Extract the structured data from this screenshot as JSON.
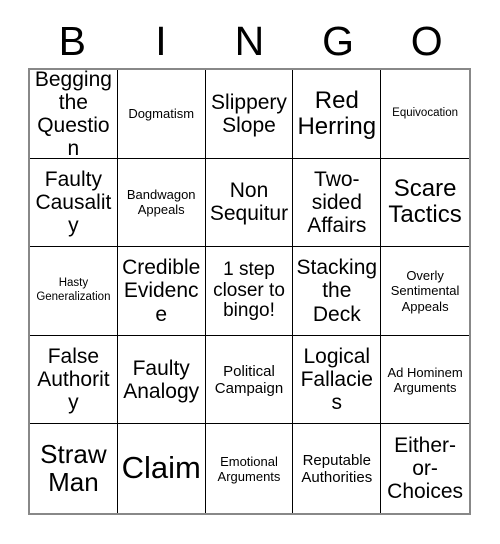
{
  "card": {
    "header_letters": [
      "B",
      "I",
      "N",
      "G",
      "O"
    ],
    "size": 5,
    "cells": [
      {
        "text": "Begging the Question",
        "size": "fs-xl"
      },
      {
        "text": "Dogmatism",
        "size": "fs-sm"
      },
      {
        "text": "Slippery Slope",
        "size": "fs-xl"
      },
      {
        "text": "Red Herring",
        "size": "fs-2xl"
      },
      {
        "text": "Equivocation",
        "size": "fs-xs"
      },
      {
        "text": "Faulty Causality",
        "size": "fs-xl"
      },
      {
        "text": "Bandwagon Appeals",
        "size": "fs-sm"
      },
      {
        "text": "Non Sequitur",
        "size": "fs-xl"
      },
      {
        "text": "Two-sided Affairs",
        "size": "fs-xl"
      },
      {
        "text": "Scare Tactics",
        "size": "fs-2xl"
      },
      {
        "text": "Hasty Generalization",
        "size": "fs-xs"
      },
      {
        "text": "Credible Evidence",
        "size": "fs-xl"
      },
      {
        "text": "1 step closer to bingo!",
        "size": "fs-lg"
      },
      {
        "text": "Stacking the Deck",
        "size": "fs-xl"
      },
      {
        "text": "Overly Sentimental Appeals",
        "size": "fs-sm"
      },
      {
        "text": "False Authority",
        "size": "fs-xl"
      },
      {
        "text": "Faulty Analogy",
        "size": "fs-xl"
      },
      {
        "text": "Political Campaign",
        "size": "fs-md"
      },
      {
        "text": "Logical Fallacies",
        "size": "fs-xl"
      },
      {
        "text": "Ad Hominem Arguments",
        "size": "fs-sm"
      },
      {
        "text": "Straw Man",
        "size": "fs-3xl"
      },
      {
        "text": "Claim",
        "size": "fs-4xl"
      },
      {
        "text": "Emotional Arguments",
        "size": "fs-sm"
      },
      {
        "text": "Reputable Authorities",
        "size": "fs-md"
      },
      {
        "text": "Either-or-Choices",
        "size": "fs-xl"
      }
    ]
  },
  "colors": {
    "background": "#ffffff",
    "text": "#000000",
    "cell_border": "#000000",
    "outer_border": "#888888"
  }
}
